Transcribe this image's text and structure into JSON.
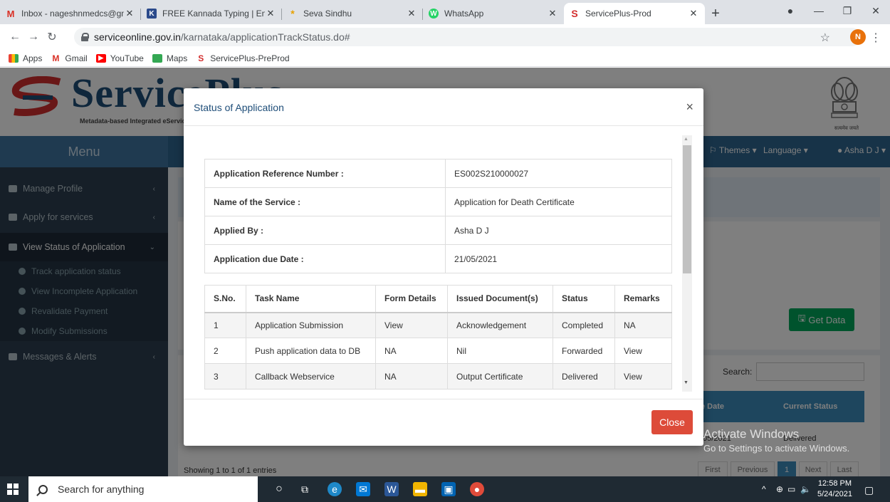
{
  "browser": {
    "tabs": [
      {
        "label": "Inbox - nageshnmedcs@gma",
        "favicon": "M"
      },
      {
        "label": "FREE Kannada Typing | Englis",
        "favicon": "K"
      },
      {
        "label": "Seva Sindhu",
        "favicon": "*"
      },
      {
        "label": "WhatsApp",
        "favicon": "W"
      },
      {
        "label": "ServicePlus-Prod",
        "favicon": "S"
      }
    ],
    "url_host": "serviceonline.gov.in",
    "url_path": "/karnataka/applicationTrackStatus.do#",
    "profile_initial": "N",
    "bookmarks": [
      "Apps",
      "Gmail",
      "YouTube",
      "Maps",
      "ServicePlus-PreProd"
    ]
  },
  "site": {
    "logo": "ServicePlus",
    "logo_sub": "Metadata-based Integrated eService Delivery Framework",
    "emblem_caption": "सत्यमेव जयते",
    "menu_label": "Menu",
    "topnav": {
      "themes": "Themes",
      "language": "Language",
      "user": "Asha D J"
    },
    "sidebar": [
      {
        "label": "Manage Profile"
      },
      {
        "label": "Apply for services"
      },
      {
        "label": "View Status of Application"
      },
      {
        "label": "Messages & Alerts"
      }
    ],
    "sidebar_sub": [
      "Track application status",
      "View Incomplete Application",
      "Revalidate Payment",
      "Modify Submissions"
    ],
    "get_data": "Get Data",
    "search_label": "Search:",
    "col_date": "e Date",
    "col_status": "Current Status",
    "showing": "Showing 1 to 1 of 1 entries",
    "row_date": "/05/2021",
    "row_status": "Delivered",
    "pager": [
      "First",
      "Previous",
      "1",
      "Next",
      "Last"
    ]
  },
  "modal": {
    "title": "Status of Application",
    "close_label": "Close",
    "info": [
      {
        "key": "Application Reference Number :",
        "value": "ES002S210000027"
      },
      {
        "key": "Name of the Service :",
        "value": "Application for Death Certificate"
      },
      {
        "key": "Applied By :",
        "value": "Asha D J"
      },
      {
        "key": "Application due Date :",
        "value": "21/05/2021"
      }
    ],
    "task_headers": [
      "S.No.",
      "Task Name",
      "Form Details",
      "Issued Document(s)",
      "Status",
      "Remarks"
    ],
    "tasks": [
      {
        "sno": "1",
        "task": "Application Submission",
        "form": "View",
        "doc": "Acknowledgement",
        "status": "Completed",
        "remarks": "NA"
      },
      {
        "sno": "2",
        "task": "Push application data to DB",
        "form": "NA",
        "doc": "Nil",
        "status": "Forwarded",
        "remarks": "View"
      },
      {
        "sno": "3",
        "task": "Callback Webservice",
        "form": "NA",
        "doc": "Output Certificate",
        "status": "Delivered",
        "remarks": "View"
      }
    ]
  },
  "watermark": {
    "line1": "Activate Windows",
    "line2": "Go to Settings to activate Windows."
  },
  "taskbar": {
    "search_placeholder": "Search for anything",
    "time": "12:58 PM",
    "date": "5/24/2021"
  }
}
